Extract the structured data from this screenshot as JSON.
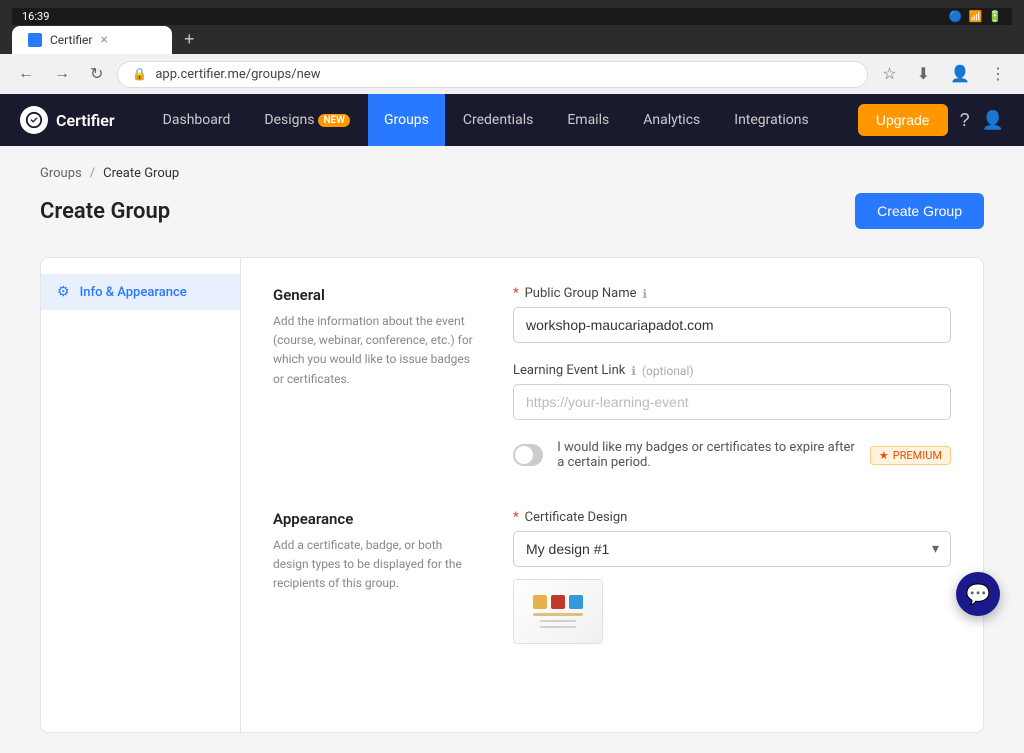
{
  "browser": {
    "time": "16:39",
    "status_icons": "🔵 🔵 📶 🔋",
    "tab_title": "Certifier",
    "tab_new": "+",
    "address": "app.certifier.me/groups/new",
    "close_tab": "×"
  },
  "nav": {
    "logo_text": "Certifier",
    "items": [
      {
        "label": "Dashboard",
        "active": false,
        "badge": null
      },
      {
        "label": "Designs",
        "active": false,
        "badge": "NEW"
      },
      {
        "label": "Groups",
        "active": true,
        "badge": null
      },
      {
        "label": "Credentials",
        "active": false,
        "badge": null
      },
      {
        "label": "Emails",
        "active": false,
        "badge": null
      },
      {
        "label": "Analytics",
        "active": false,
        "badge": null
      },
      {
        "label": "Integrations",
        "active": false,
        "badge": null
      }
    ],
    "upgrade_label": "Upgrade",
    "help_icon": "?",
    "user_icon": "👤"
  },
  "breadcrumb": {
    "parent": "Groups",
    "separator": "/",
    "current": "Create Group"
  },
  "page": {
    "title": "Create Group",
    "create_button": "Create Group"
  },
  "sidebar": {
    "items": [
      {
        "label": "Info & Appearance",
        "active": true,
        "icon": "⚙"
      }
    ]
  },
  "form": {
    "general": {
      "title": "General",
      "description": "Add the information about the event (course, webinar, conference, etc.) for which you would like to issue badges or certificates."
    },
    "public_group_name": {
      "label": "Public Group Name",
      "required": true,
      "value": "workshop-maucariapadot.com",
      "info_icon": "ℹ"
    },
    "learning_event_link": {
      "label": "Learning Event Link",
      "required": false,
      "optional_text": "(optional)",
      "placeholder": "https://your-learning-event",
      "info_icon": "ℹ"
    },
    "expiry_toggle": {
      "label": "I would like my badges or certificates to expire after a certain period.",
      "enabled": false,
      "premium_badge": "★ PREMIUM"
    },
    "appearance": {
      "title": "Appearance",
      "description": "Add a certificate, badge, or both design types to be displayed for the recipients of this group."
    },
    "certificate_design": {
      "label": "Certificate Design",
      "required": true,
      "selected": "My design #1"
    }
  },
  "chat": {
    "icon": "💬"
  }
}
